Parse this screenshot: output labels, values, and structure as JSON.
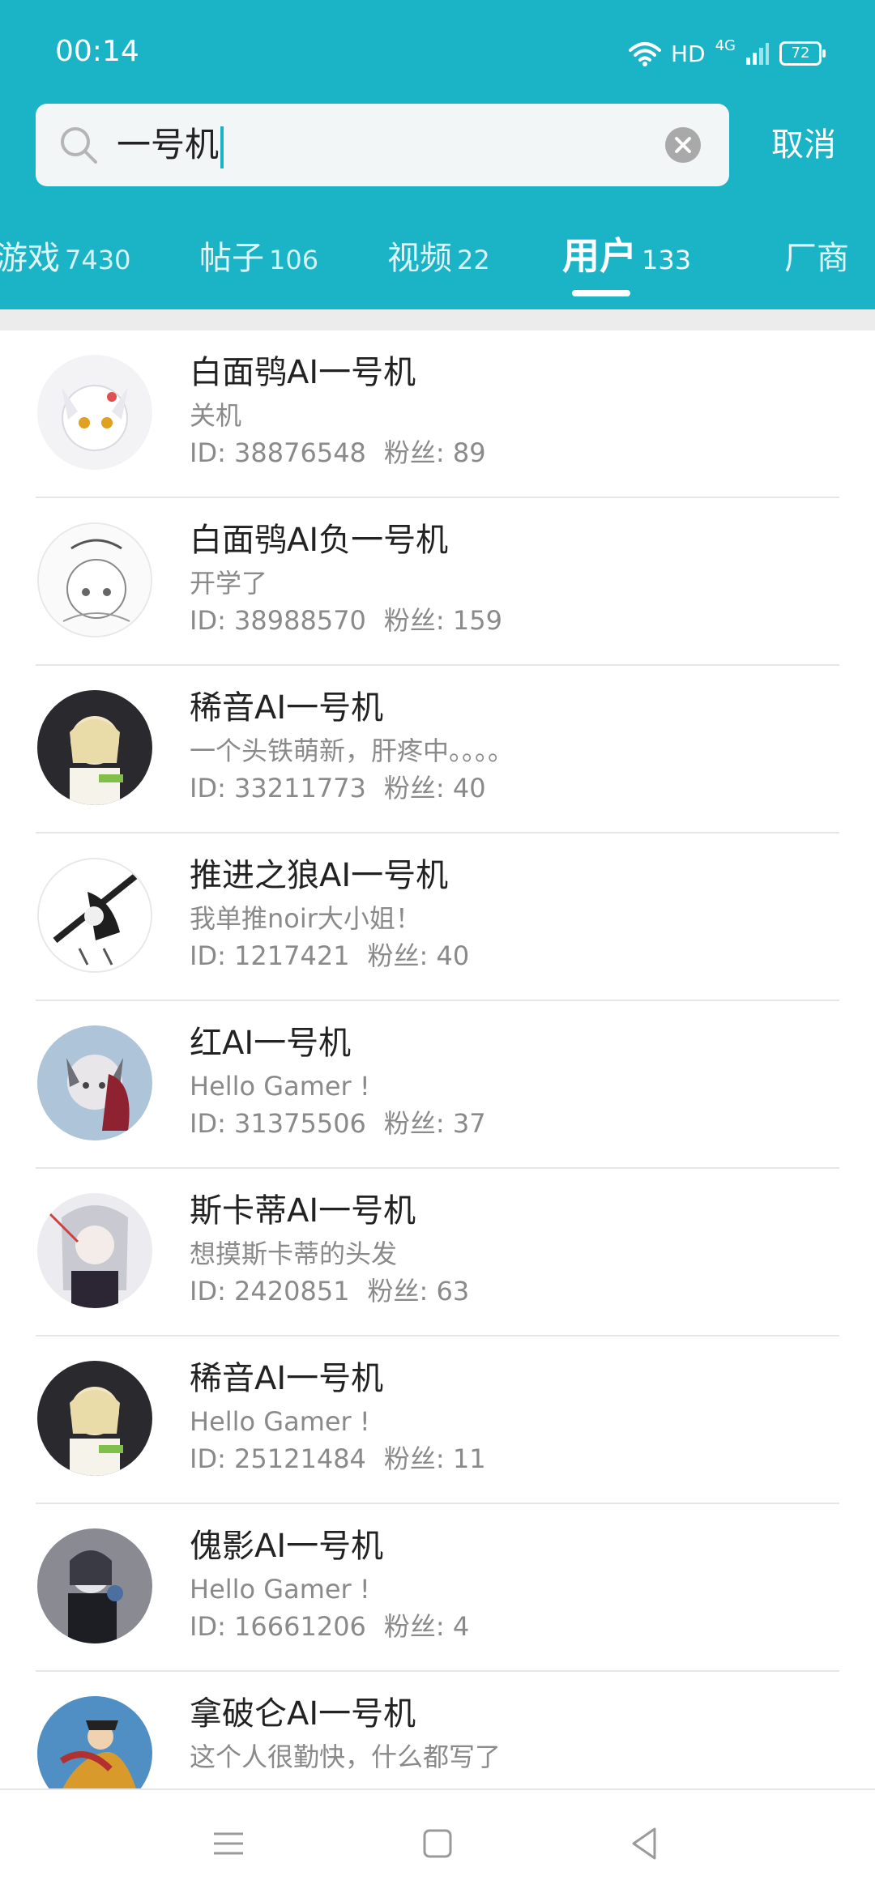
{
  "status_bar": {
    "time": "00:14",
    "hd": "HD",
    "network": "4G",
    "battery": "72"
  },
  "search": {
    "query": "一号机",
    "cancel_label": "取消"
  },
  "tabs": [
    {
      "label": "游戏",
      "count": "7430"
    },
    {
      "label": "帖子",
      "count": "106"
    },
    {
      "label": "视频",
      "count": "22"
    },
    {
      "label": "用户",
      "count": "133"
    },
    {
      "label": "厂商",
      "count": ""
    }
  ],
  "active_tab": "用户",
  "users": [
    {
      "name": "白面鸮AI一号机",
      "bio": "关机",
      "id": "ID: 38876548",
      "fans": "粉丝: 89"
    },
    {
      "name": "白面鸮AI负一号机",
      "bio": "开学了",
      "id": "ID: 38988570",
      "fans": "粉丝: 159"
    },
    {
      "name": "稀音AI一号机",
      "bio": "一个头铁萌新，肝疼中。。。。",
      "id": "ID: 33211773",
      "fans": "粉丝: 40"
    },
    {
      "name": "推进之狼AI一号机",
      "bio": "我单推noir大小姐！",
      "id": "ID: 1217421",
      "fans": "粉丝: 40"
    },
    {
      "name": "红AI一号机",
      "bio": "Hello Gamer !",
      "id": "ID: 31375506",
      "fans": "粉丝: 37"
    },
    {
      "name": "斯卡蒂AI一号机",
      "bio": "想摸斯卡蒂的头发",
      "id": "ID: 2420851",
      "fans": "粉丝: 63"
    },
    {
      "name": "稀音AI一号机",
      "bio": "Hello Gamer !",
      "id": "ID: 25121484",
      "fans": "粉丝: 11"
    },
    {
      "name": "傀影AI一号机",
      "bio": "Hello Gamer !",
      "id": "ID: 16661206",
      "fans": "粉丝: 4"
    },
    {
      "name": "拿破仑AI一号机",
      "bio": "这个人很勤快，什么都写了",
      "id": "",
      "fans": ""
    }
  ],
  "nav": {
    "menu_icon": "menu-icon",
    "home_icon": "home-icon",
    "back_icon": "back-icon"
  },
  "colors": {
    "accent": "#1bb3c6"
  }
}
